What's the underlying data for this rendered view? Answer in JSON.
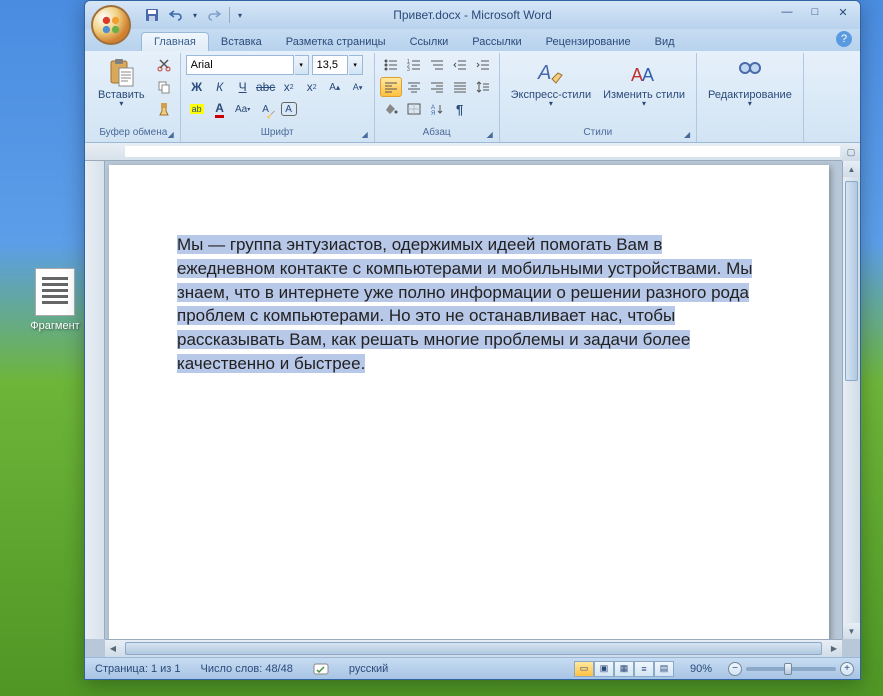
{
  "desktop": {
    "icon_label": "Фрагмент"
  },
  "window": {
    "title": "Привет.docx - Microsoft Word",
    "qat": {
      "save": "💾",
      "undo": "↶",
      "redo": "↻"
    }
  },
  "tabs": [
    "Главная",
    "Вставка",
    "Разметка страницы",
    "Ссылки",
    "Рассылки",
    "Рецензирование",
    "Вид"
  ],
  "active_tab": 0,
  "ribbon": {
    "clipboard": {
      "label": "Буфер обмена",
      "paste": "Вставить"
    },
    "font": {
      "label": "Шрифт",
      "name": "Arial",
      "size": "13,5",
      "bold": "Ж",
      "italic": "К",
      "underline": "Ч"
    },
    "paragraph": {
      "label": "Абзац"
    },
    "styles": {
      "label": "Стили",
      "quick": "Экспресс-стили",
      "change": "Изменить стили"
    },
    "editing": {
      "label": "Редактирование"
    }
  },
  "document": {
    "body": "Мы — группа энтузиастов, одержимых идеей помогать Вам в ежедневном контакте с компьютерами и мобильными устройствами. Мы знаем, что в интернете уже полно информации о решении разного рода проблем с компьютерами. Но это не останавливает нас, чтобы рассказывать Вам, как решать многие проблемы и задачи более качественно и быстрее."
  },
  "status": {
    "page": "Страница: 1 из 1",
    "words": "Число слов: 48/48",
    "lang": "русский",
    "zoom": "90%"
  }
}
